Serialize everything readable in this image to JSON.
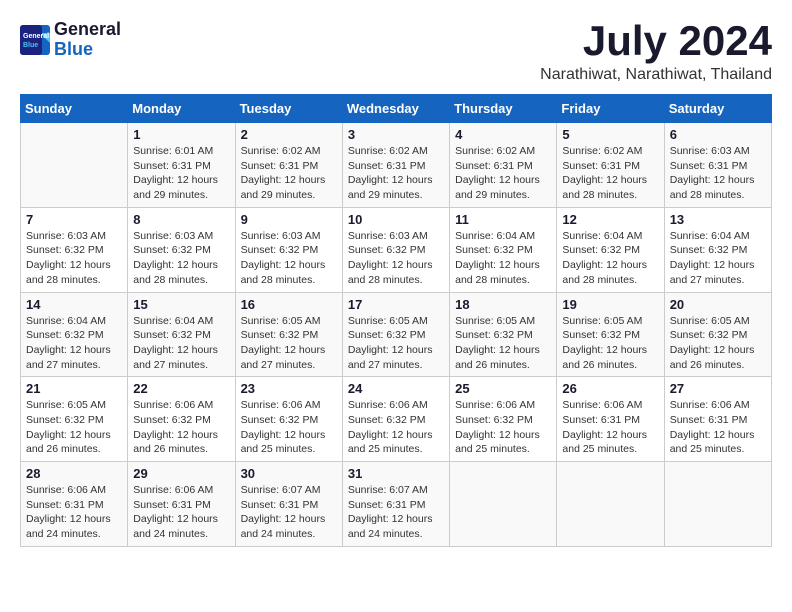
{
  "header": {
    "logo_general": "General",
    "logo_blue": "Blue",
    "title": "July 2024",
    "location": "Narathiwat, Narathiwat, Thailand"
  },
  "days_of_week": [
    "Sunday",
    "Monday",
    "Tuesday",
    "Wednesday",
    "Thursday",
    "Friday",
    "Saturday"
  ],
  "weeks": [
    [
      {
        "day": "",
        "info": ""
      },
      {
        "day": "1",
        "info": "Sunrise: 6:01 AM\nSunset: 6:31 PM\nDaylight: 12 hours\nand 29 minutes."
      },
      {
        "day": "2",
        "info": "Sunrise: 6:02 AM\nSunset: 6:31 PM\nDaylight: 12 hours\nand 29 minutes."
      },
      {
        "day": "3",
        "info": "Sunrise: 6:02 AM\nSunset: 6:31 PM\nDaylight: 12 hours\nand 29 minutes."
      },
      {
        "day": "4",
        "info": "Sunrise: 6:02 AM\nSunset: 6:31 PM\nDaylight: 12 hours\nand 29 minutes."
      },
      {
        "day": "5",
        "info": "Sunrise: 6:02 AM\nSunset: 6:31 PM\nDaylight: 12 hours\nand 28 minutes."
      },
      {
        "day": "6",
        "info": "Sunrise: 6:03 AM\nSunset: 6:31 PM\nDaylight: 12 hours\nand 28 minutes."
      }
    ],
    [
      {
        "day": "7",
        "info": "Sunrise: 6:03 AM\nSunset: 6:32 PM\nDaylight: 12 hours\nand 28 minutes."
      },
      {
        "day": "8",
        "info": "Sunrise: 6:03 AM\nSunset: 6:32 PM\nDaylight: 12 hours\nand 28 minutes."
      },
      {
        "day": "9",
        "info": "Sunrise: 6:03 AM\nSunset: 6:32 PM\nDaylight: 12 hours\nand 28 minutes."
      },
      {
        "day": "10",
        "info": "Sunrise: 6:03 AM\nSunset: 6:32 PM\nDaylight: 12 hours\nand 28 minutes."
      },
      {
        "day": "11",
        "info": "Sunrise: 6:04 AM\nSunset: 6:32 PM\nDaylight: 12 hours\nand 28 minutes."
      },
      {
        "day": "12",
        "info": "Sunrise: 6:04 AM\nSunset: 6:32 PM\nDaylight: 12 hours\nand 28 minutes."
      },
      {
        "day": "13",
        "info": "Sunrise: 6:04 AM\nSunset: 6:32 PM\nDaylight: 12 hours\nand 27 minutes."
      }
    ],
    [
      {
        "day": "14",
        "info": "Sunrise: 6:04 AM\nSunset: 6:32 PM\nDaylight: 12 hours\nand 27 minutes."
      },
      {
        "day": "15",
        "info": "Sunrise: 6:04 AM\nSunset: 6:32 PM\nDaylight: 12 hours\nand 27 minutes."
      },
      {
        "day": "16",
        "info": "Sunrise: 6:05 AM\nSunset: 6:32 PM\nDaylight: 12 hours\nand 27 minutes."
      },
      {
        "day": "17",
        "info": "Sunrise: 6:05 AM\nSunset: 6:32 PM\nDaylight: 12 hours\nand 27 minutes."
      },
      {
        "day": "18",
        "info": "Sunrise: 6:05 AM\nSunset: 6:32 PM\nDaylight: 12 hours\nand 26 minutes."
      },
      {
        "day": "19",
        "info": "Sunrise: 6:05 AM\nSunset: 6:32 PM\nDaylight: 12 hours\nand 26 minutes."
      },
      {
        "day": "20",
        "info": "Sunrise: 6:05 AM\nSunset: 6:32 PM\nDaylight: 12 hours\nand 26 minutes."
      }
    ],
    [
      {
        "day": "21",
        "info": "Sunrise: 6:05 AM\nSunset: 6:32 PM\nDaylight: 12 hours\nand 26 minutes."
      },
      {
        "day": "22",
        "info": "Sunrise: 6:06 AM\nSunset: 6:32 PM\nDaylight: 12 hours\nand 26 minutes."
      },
      {
        "day": "23",
        "info": "Sunrise: 6:06 AM\nSunset: 6:32 PM\nDaylight: 12 hours\nand 25 minutes."
      },
      {
        "day": "24",
        "info": "Sunrise: 6:06 AM\nSunset: 6:32 PM\nDaylight: 12 hours\nand 25 minutes."
      },
      {
        "day": "25",
        "info": "Sunrise: 6:06 AM\nSunset: 6:32 PM\nDaylight: 12 hours\nand 25 minutes."
      },
      {
        "day": "26",
        "info": "Sunrise: 6:06 AM\nSunset: 6:31 PM\nDaylight: 12 hours\nand 25 minutes."
      },
      {
        "day": "27",
        "info": "Sunrise: 6:06 AM\nSunset: 6:31 PM\nDaylight: 12 hours\nand 25 minutes."
      }
    ],
    [
      {
        "day": "28",
        "info": "Sunrise: 6:06 AM\nSunset: 6:31 PM\nDaylight: 12 hours\nand 24 minutes."
      },
      {
        "day": "29",
        "info": "Sunrise: 6:06 AM\nSunset: 6:31 PM\nDaylight: 12 hours\nand 24 minutes."
      },
      {
        "day": "30",
        "info": "Sunrise: 6:07 AM\nSunset: 6:31 PM\nDaylight: 12 hours\nand 24 minutes."
      },
      {
        "day": "31",
        "info": "Sunrise: 6:07 AM\nSunset: 6:31 PM\nDaylight: 12 hours\nand 24 minutes."
      },
      {
        "day": "",
        "info": ""
      },
      {
        "day": "",
        "info": ""
      },
      {
        "day": "",
        "info": ""
      }
    ]
  ]
}
